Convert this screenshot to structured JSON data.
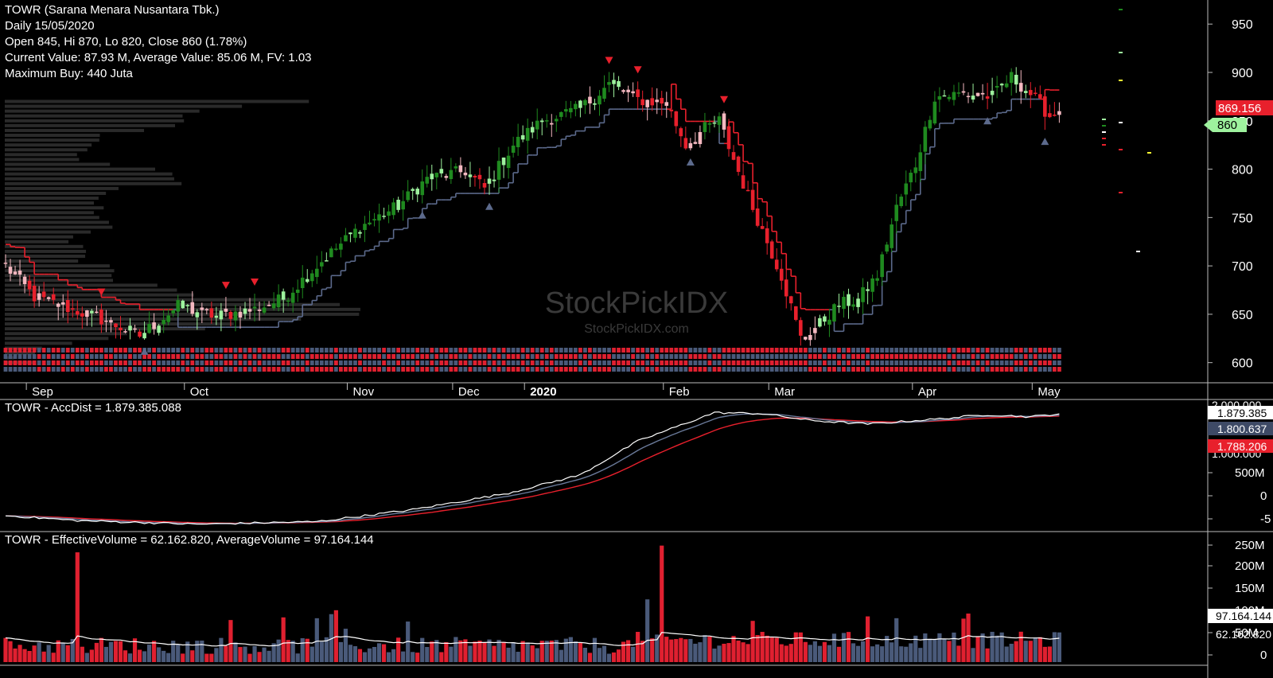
{
  "info": {
    "line1": "TOWR (Sarana Menara Nusantara Tbk.)",
    "line2": "Daily 15/05/2020",
    "line3": "Open 845, Hi 870, Lo 820, Close 860 (1.78%)",
    "line4": "Current Value: 87.93 M, Average Value: 85.06 M, FV: 1.03",
    "line5": "Maximum Buy: 440 Juta"
  },
  "watermark": {
    "main": "StockPickIDX",
    "sub": "StockPickIDX.com"
  },
  "colors": {
    "background": "#000000",
    "strong_up": "#1f8a1f",
    "weak_up": "#9ef29e",
    "strong_down": "#e8202c",
    "weak_down": "#f4b8c0",
    "neutral": "#ffffff",
    "stop_up": "#5c6a8c",
    "stop_down": "#e8202c",
    "stop_flat": "#ffff33",
    "volume_up": "#4a5a7a",
    "volume_down": "#e02030",
    "accdist_line": "#ffffff",
    "accdist_ma1": "#6a7a9a",
    "accdist_ma2": "#e8202c",
    "price_marker": "#e8202c",
    "close_marker": "#9ef29e"
  },
  "chart_data": [
    {
      "type": "candlestick",
      "panel": "price",
      "symbol": "TOWR",
      "interval": "Daily",
      "x_labels": [
        "Sep",
        "Oct",
        "Nov",
        "Dec",
        "2020",
        "Feb",
        "Mar",
        "Apr",
        "May"
      ],
      "y_ticks": [
        600,
        650,
        700,
        750,
        800,
        850,
        900,
        950
      ],
      "ylim": [
        580,
        965
      ],
      "last_close": 860,
      "last_close_label": "860",
      "stop_label": "869.156",
      "stop_value": 869.156,
      "anchors": [
        {
          "i": 0,
          "c": 700
        },
        {
          "i": 6,
          "c": 668
        },
        {
          "i": 14,
          "c": 655
        },
        {
          "i": 20,
          "c": 645
        },
        {
          "i": 28,
          "c": 628
        },
        {
          "i": 36,
          "c": 658
        },
        {
          "i": 44,
          "c": 648
        },
        {
          "i": 52,
          "c": 655
        },
        {
          "i": 58,
          "c": 666
        },
        {
          "i": 66,
          "c": 705
        },
        {
          "i": 74,
          "c": 740
        },
        {
          "i": 82,
          "c": 762
        },
        {
          "i": 88,
          "c": 790
        },
        {
          "i": 96,
          "c": 798
        },
        {
          "i": 100,
          "c": 780
        },
        {
          "i": 106,
          "c": 825
        },
        {
          "i": 112,
          "c": 850
        },
        {
          "i": 120,
          "c": 862
        },
        {
          "i": 126,
          "c": 888
        },
        {
          "i": 132,
          "c": 872
        },
        {
          "i": 138,
          "c": 868
        },
        {
          "i": 142,
          "c": 825
        },
        {
          "i": 146,
          "c": 842
        },
        {
          "i": 149,
          "c": 850
        },
        {
          "i": 152,
          "c": 810
        },
        {
          "i": 156,
          "c": 760
        },
        {
          "i": 162,
          "c": 690
        },
        {
          "i": 166,
          "c": 625
        },
        {
          "i": 170,
          "c": 640
        },
        {
          "i": 174,
          "c": 660
        },
        {
          "i": 178,
          "c": 665
        },
        {
          "i": 182,
          "c": 690
        },
        {
          "i": 186,
          "c": 760
        },
        {
          "i": 190,
          "c": 805
        },
        {
          "i": 194,
          "c": 875
        },
        {
          "i": 200,
          "c": 878
        },
        {
          "i": 206,
          "c": 875
        },
        {
          "i": 210,
          "c": 895
        },
        {
          "i": 214,
          "c": 878
        },
        {
          "i": 218,
          "c": 855
        },
        {
          "i": 220,
          "c": 860
        }
      ]
    },
    {
      "type": "line",
      "panel": "accdist",
      "title": "TOWR - AccDist = 1.879.385.088",
      "y_ticks": [
        "500M",
        "0",
        "-5"
      ],
      "value_labels": [
        "1.879.385",
        "1.800.637",
        "1.788.206"
      ],
      "scale_top_label": "2.000.000",
      "scale_mid_label": "1.000.000",
      "anchors": [
        {
          "i": 0,
          "v": -85
        },
        {
          "i": 15,
          "v": -180
        },
        {
          "i": 40,
          "v": -250
        },
        {
          "i": 65,
          "v": -200
        },
        {
          "i": 85,
          "v": 30
        },
        {
          "i": 105,
          "v": 350
        },
        {
          "i": 120,
          "v": 700
        },
        {
          "i": 132,
          "v": 1350
        },
        {
          "i": 148,
          "v": 1900
        },
        {
          "i": 158,
          "v": 1880
        },
        {
          "i": 168,
          "v": 1750
        },
        {
          "i": 180,
          "v": 1680
        },
        {
          "i": 195,
          "v": 1780
        },
        {
          "i": 205,
          "v": 1860
        },
        {
          "i": 214,
          "v": 1820
        },
        {
          "i": 220,
          "v": 1879
        }
      ],
      "ylim": [
        -300,
        2000
      ]
    },
    {
      "type": "bar",
      "panel": "volume",
      "title": "TOWR - EffectiveVolume = 62.162.820, AverageVolume = 97.164.144",
      "y_ticks": [
        "250M",
        "200M",
        "150M",
        "100M",
        "50M",
        "0"
      ],
      "ylim": [
        0,
        270
      ],
      "value_labels": [
        "97.164.144",
        "62.162.820"
      ],
      "spikes": [
        {
          "i": 15,
          "v": 245
        },
        {
          "i": 137,
          "v": 260
        },
        {
          "i": 134,
          "v": 140
        },
        {
          "i": 156,
          "v": 92
        },
        {
          "i": 180,
          "v": 102
        },
        {
          "i": 186,
          "v": 98
        },
        {
          "i": 200,
          "v": 97
        }
      ]
    }
  ]
}
